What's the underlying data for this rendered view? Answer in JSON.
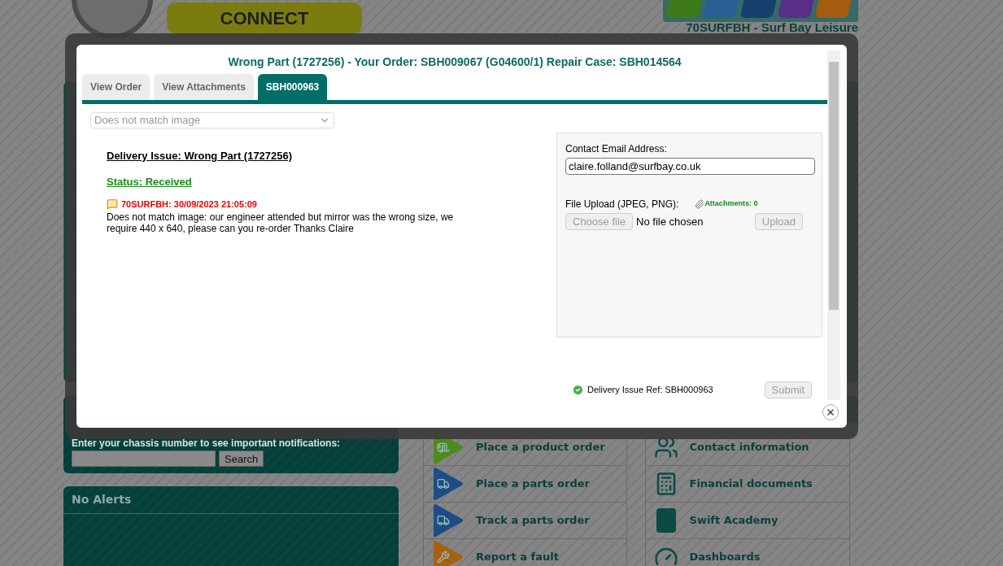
{
  "header": {
    "logo_text": "CONNECT",
    "account": "70SURFBH - Surf Bay Leisure"
  },
  "modal": {
    "title": "Wrong Part (1727256) - Your Order: SBH009067 (G04600/1) Repair Case: SBH014564",
    "tabs": [
      {
        "label": "View Order",
        "selected": false
      },
      {
        "label": "View Attachments",
        "selected": false
      },
      {
        "label": "SBH000963",
        "selected": true
      }
    ],
    "reason_select": {
      "value": "Does not match image",
      "disabled": true
    },
    "issue_heading": "Delivery Issue: Wrong Part (1727256)",
    "status": "Status: Received",
    "comments": [
      {
        "author_time": "70SURFBH: 30/09/2023 21:05:09",
        "text": "Does not match image: our engineer attended but mirror was the wrong size, we require 440 x 640, please can you re-order Thanks Claire"
      }
    ],
    "form": {
      "email_label": "Contact Email Address:",
      "email_value": "claire.folland@surfbay.co.uk",
      "upload_label": "File Upload (JPEG, PNG):",
      "attachments": "Attachments: 0",
      "choose_button": {
        "label": "Choose file",
        "disabled": true
      },
      "file_status": "No file chosen",
      "upload_button": {
        "label": "Upload",
        "disabled": true
      }
    },
    "reference": "Delivery Issue Ref: SBH000963",
    "submit_button": {
      "label": "Submit",
      "disabled": true
    }
  },
  "chassis_panel": {
    "prompt": "Enter your chassis number to see important notifications:",
    "search_button": "Search"
  },
  "alerts_panel": {
    "title": "No Alerts"
  },
  "menu_left": [
    {
      "label": "Place a product order",
      "color": "#4e8a1c"
    },
    {
      "label": "Place a parts order",
      "color": "#1c4d86"
    },
    {
      "label": "Track a parts order",
      "color": "#1c4d86"
    },
    {
      "label": "Report a fault",
      "color": "#a8610f"
    }
  ],
  "menu_right": [
    {
      "label": "Contact information"
    },
    {
      "label": "Financial documents"
    },
    {
      "label": "Swift Academy"
    },
    {
      "label": "Dashboards"
    }
  ]
}
